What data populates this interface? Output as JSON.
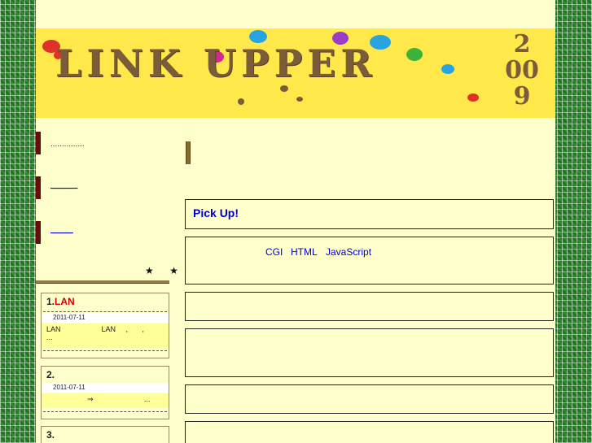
{
  "banner": {
    "title": "LINK UPPER",
    "year_digits": [
      "2",
      "00",
      "9"
    ]
  },
  "sidebar": {
    "nav": [
      {
        "label": "..............."
      },
      {
        "label": "______"
      },
      {
        "label": "_____"
      }
    ],
    "stars": "★ ★",
    "entries": [
      {
        "num": "1.",
        "highlight": "LAN",
        "date": "2011-07-11",
        "body_line1": "LAN                    LAN     ,       ,",
        "body_line2": "..."
      },
      {
        "num": "2.",
        "highlight": "",
        "date": "2011-07-11",
        "body_line1": "⇒                         ...",
        "body_line2": ""
      },
      {
        "num": "3.",
        "highlight": "",
        "date": "",
        "body_line1": "",
        "body_line2": ""
      }
    ]
  },
  "main": {
    "pickup_label": "Pick Up!",
    "tags": [
      "CGI",
      "HTML",
      "JavaScript"
    ]
  },
  "colors": {
    "page_bg": "#ffffcc",
    "banner_bg": "#ffe94a",
    "link": "#0000cc",
    "accent_red": "#d40000",
    "nav_bar": "#6b0c0c",
    "border_green": "#2f8a2f"
  }
}
